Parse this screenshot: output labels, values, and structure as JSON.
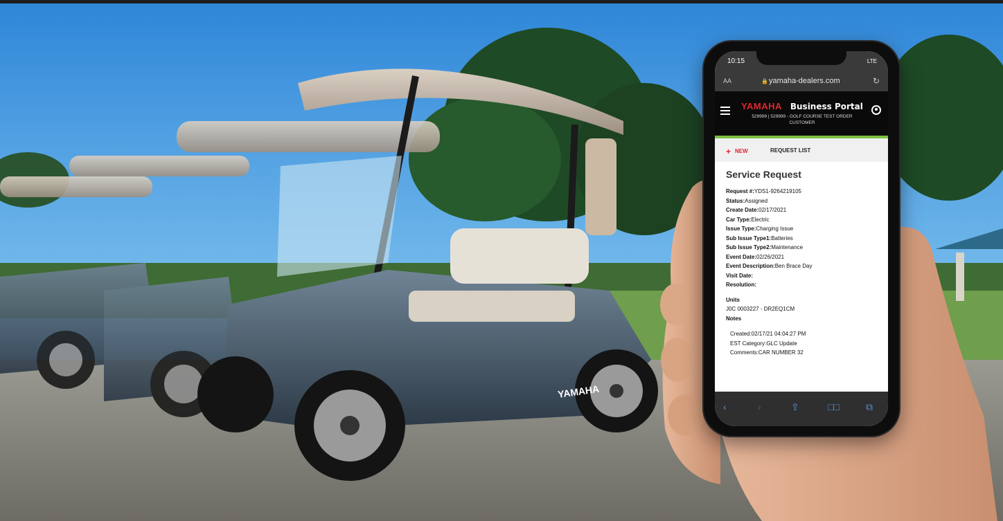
{
  "status_bar": {
    "time": "10:15",
    "signal": "LTE"
  },
  "browser": {
    "text_size": "AA",
    "url": "yamaha-dealers.com",
    "reload_icon": "reload-icon"
  },
  "header": {
    "brand": "YAMAHA",
    "portal_title": "Business Portal",
    "account_line": "529999 | 529999 - GOLF COURSE TEST ORDER CUSTOMER",
    "brand_color": "#e0262e",
    "accent_color": "#7cbf3f"
  },
  "tabs": {
    "new_label": "NEW",
    "list_label": "REQUEST LIST"
  },
  "service_request": {
    "title": "Service Request",
    "fields": [
      {
        "label": "Request #:",
        "value": "YDS1-9264219105"
      },
      {
        "label": "Status:",
        "value": "Assigned"
      },
      {
        "label": "Create Date:",
        "value": "02/17/2021"
      },
      {
        "label": "Car Type:",
        "value": "Electric"
      },
      {
        "label": "Issue Type:",
        "value": "Charging Issue"
      },
      {
        "label": "Sub Issue Type1:",
        "value": "Batteries"
      },
      {
        "label": "Sub Issue Type2:",
        "value": "Maintenance"
      },
      {
        "label": "Event Date:",
        "value": "02/26/2021"
      },
      {
        "label": "Event Description:",
        "value": "Ben Brace Day"
      },
      {
        "label": "Visit Date:",
        "value": ""
      },
      {
        "label": "Resolution:",
        "value": ""
      }
    ],
    "units_label": "Units",
    "unit_value": "J0C 0003227 - DR2EQ1CM",
    "notes_label": "Notes",
    "note": {
      "created": "Created:02/17/21 04:04:27 PM",
      "category": "EST  Category:GLC Update",
      "comments": "Comments:CAR NUMBER 32"
    }
  }
}
